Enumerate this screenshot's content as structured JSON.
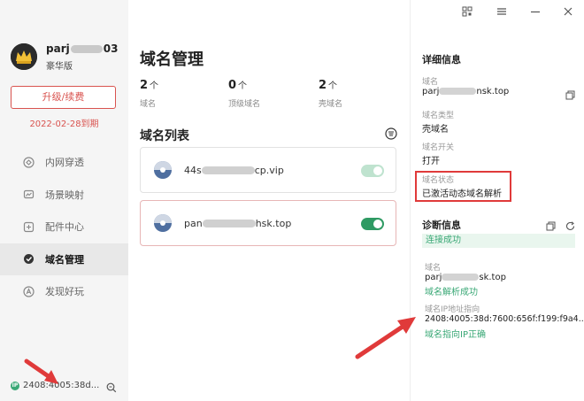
{
  "sidebar": {
    "username_prefix": "parj",
    "username_suffix": "03",
    "edition": "豪华版",
    "upgrade_label": "升级/续费",
    "expire_text": "2022-02-28到期",
    "nav": [
      {
        "label": "内网穿透",
        "icon": "tunnel-icon"
      },
      {
        "label": "场景映射",
        "icon": "scene-icon"
      },
      {
        "label": "配件中心",
        "icon": "accessory-icon"
      },
      {
        "label": "域名管理",
        "icon": "domain-icon",
        "active": true
      },
      {
        "label": "发现好玩",
        "icon": "discover-icon"
      }
    ],
    "ip_badge": "IP",
    "ip_text": "2408:4005:38d..."
  },
  "main": {
    "title": "域名管理",
    "stats": [
      {
        "num": "2",
        "unit": "个",
        "label": "域名"
      },
      {
        "num": "0",
        "unit": "个",
        "label": "顶级域名"
      },
      {
        "num": "2",
        "unit": "个",
        "label": "壳域名"
      }
    ],
    "list_title": "域名列表",
    "domains": [
      {
        "name_prefix": "44s",
        "name_suffix": "cp.vip",
        "enabled": true,
        "toggle_color": "#bfe3cf"
      },
      {
        "name_prefix": "pan",
        "name_suffix": "hsk.top",
        "enabled": true,
        "toggle_color": "#2f9a63",
        "selected": true
      }
    ]
  },
  "detail": {
    "section_title": "详细信息",
    "domain_label": "域名",
    "domain_value_prefix": "parj",
    "domain_value_suffix": "nsk.top",
    "type_label": "域名类型",
    "type_value": "壳域名",
    "switch_label": "域名开关",
    "switch_value": "打开",
    "status_label": "域名状态",
    "status_value": "已激活动态域名解析",
    "diag_title": "诊断信息",
    "conn_status": "连接成功",
    "diag_domain_label": "域名",
    "diag_domain_prefix": "parj",
    "diag_domain_suffix": "sk.top",
    "resolve_ok": "域名解析成功",
    "ip_label": "域名IP地址指向",
    "ip_value": "2408:4005:38d:7600:656f:f199:f9a4...",
    "ip_ok": "域名指向IP正确"
  },
  "colors": {
    "accent_green": "#3aa876",
    "accent_red": "#d9534f",
    "annotation_red": "#e03a3a"
  }
}
